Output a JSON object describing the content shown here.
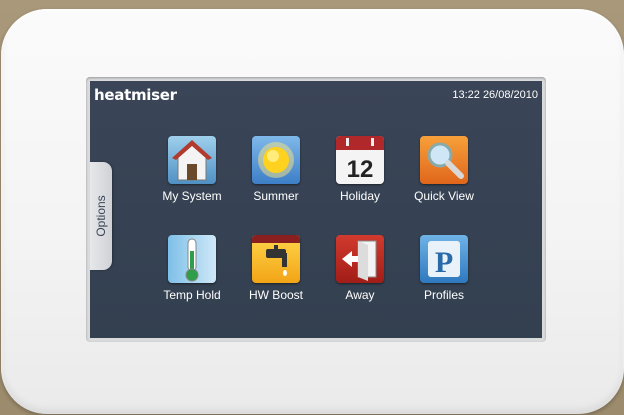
{
  "header": {
    "logo": "heatmiser",
    "datetime": "13:22 26/08/2010"
  },
  "options_tab": {
    "label": "Options"
  },
  "tiles": [
    {
      "label": "My System",
      "icon": "house-icon"
    },
    {
      "label": "Summer",
      "icon": "sun-icon"
    },
    {
      "label": "Holiday",
      "icon": "calendar-icon",
      "icon_text": "12"
    },
    {
      "label": "Quick View",
      "icon": "magnifier-icon"
    },
    {
      "label": "Temp Hold",
      "icon": "thermometer-icon"
    },
    {
      "label": "HW Boost",
      "icon": "hot-water-tap-icon"
    },
    {
      "label": "Away",
      "icon": "exit-door-icon"
    },
    {
      "label": "Profiles",
      "icon": "profiles-icon",
      "icon_text": "P"
    }
  ],
  "colors": {
    "screen_bg": "#36424f",
    "device_body": "#f5f5f5",
    "wall": "#a08f70",
    "text": "#ffffff"
  }
}
